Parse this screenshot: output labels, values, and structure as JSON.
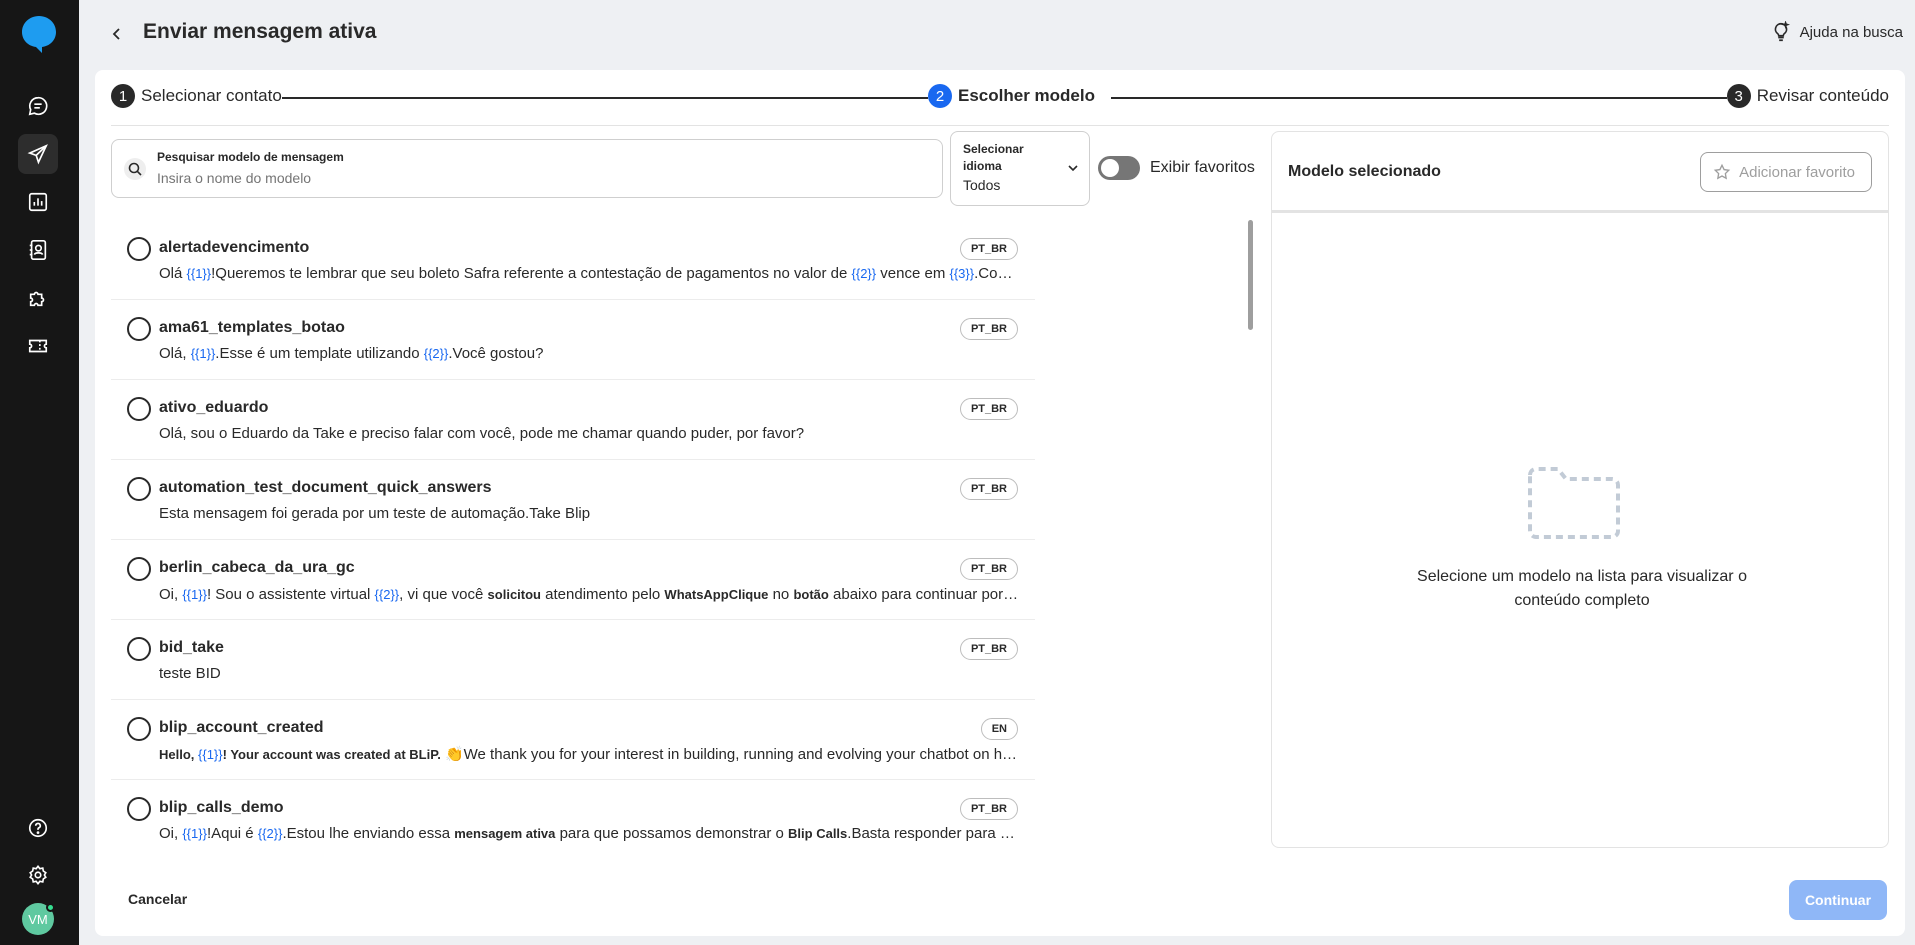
{
  "header": {
    "title": "Enviar mensagem ativa",
    "help_label": "Ajuda na busca"
  },
  "user": {
    "initials": "VM"
  },
  "stepper": [
    {
      "num": "1",
      "label": "Selecionar contato"
    },
    {
      "num": "2",
      "label": "Escolher modelo"
    },
    {
      "num": "3",
      "label": "Revisar conteúdo"
    }
  ],
  "search": {
    "label": "Pesquisar modelo de mensagem",
    "placeholder": "Insira o nome do modelo"
  },
  "language": {
    "label": "Selecionar idioma",
    "value": "Todos"
  },
  "favorites_toggle_label": "Exibir favoritos",
  "templates": [
    {
      "name": "alertadevencimento",
      "lang": "PT_BR",
      "preview": [
        {
          "t": "Olá "
        },
        {
          "v": "{{1}}"
        },
        {
          "t": "!Queremos te lembrar que seu boleto Safra referente a contestação de pagamentos no valor de "
        },
        {
          "v": "{{2}}"
        },
        {
          "t": " vence em "
        },
        {
          "v": "{{3}}"
        },
        {
          "t": ".Conforme notificação envi..."
        }
      ]
    },
    {
      "name": "ama61_templates_botao",
      "lang": "PT_BR",
      "preview": [
        {
          "t": "Olá, "
        },
        {
          "v": "{{1}}"
        },
        {
          "t": ".Esse é um template utilizando "
        },
        {
          "v": "{{2}}"
        },
        {
          "t": ".Você gostou?"
        }
      ]
    },
    {
      "name": "ativo_eduardo",
      "lang": "PT_BR",
      "preview": [
        {
          "t": "Olá, sou o Eduardo da Take e preciso falar com você, pode me chamar quando puder, por favor?"
        }
      ]
    },
    {
      "name": "automation_test_document_quick_answers",
      "lang": "PT_BR",
      "preview": [
        {
          "t": "Esta mensagem foi gerada por um teste de automação.Take Blip"
        }
      ]
    },
    {
      "name": "berlin_cabeca_da_ura_gc",
      "lang": "PT_BR",
      "preview": [
        {
          "t": "Oi, "
        },
        {
          "v": "{{1}}"
        },
        {
          "t": "! Sou o assistente virtual "
        },
        {
          "v": "{{2}}"
        },
        {
          "t": ", vi que você "
        },
        {
          "b": "solicitou"
        },
        {
          "t": " atendimento pelo "
        },
        {
          "b": "WhatsAppClique"
        },
        {
          "t": " no "
        },
        {
          "b": "botão"
        },
        {
          "t": " abaixo para continuar por aqui 👇"
        }
      ]
    },
    {
      "name": "bid_take",
      "lang": "PT_BR",
      "preview": [
        {
          "t": "teste BID"
        }
      ]
    },
    {
      "name": "blip_account_created",
      "lang": "EN",
      "preview": [
        {
          "b": "Hello, "
        },
        {
          "v": "{{1}}"
        },
        {
          "b": "! Your account was created at BLiP."
        },
        {
          "t": " 👏We thank you for your interest in building, running and evolving your chatbot on https://blip.ai.If you ne..."
        }
      ]
    },
    {
      "name": "blip_calls_demo",
      "lang": "PT_BR",
      "preview": [
        {
          "t": "Oi, "
        },
        {
          "v": "{{1}}"
        },
        {
          "t": "!Aqui é "
        },
        {
          "v": "{{2}}"
        },
        {
          "t": ".Estou lhe enviando essa "
        },
        {
          "b": "mensagem ativa"
        },
        {
          "t": " para que possamos demonstrar o "
        },
        {
          "b": "Blip Calls"
        },
        {
          "t": ".Basta responder para seguir ao atendimento ..."
        }
      ]
    }
  ],
  "panel": {
    "title": "Modelo selecionado",
    "add_favorite": "Adicionar favorito",
    "empty_text": "Selecione um modelo na lista para visualizar o conteúdo completo"
  },
  "footer": {
    "cancel": "Cancelar",
    "continue": "Continuar"
  },
  "colors": {
    "accent": "#1968f0",
    "rail": "#161616",
    "continue_disabled": "#8fb7f7",
    "brand": "#1968f0"
  },
  "icons": [
    "logo-icon",
    "chat-icon",
    "send-icon",
    "chart-icon",
    "contacts-icon",
    "puzzle-icon",
    "ticket-icon",
    "help-icon",
    "gear-icon",
    "back-icon",
    "lightbulb-icon",
    "search-icon",
    "chevron-down-icon",
    "star-icon",
    "folder-icon"
  ]
}
